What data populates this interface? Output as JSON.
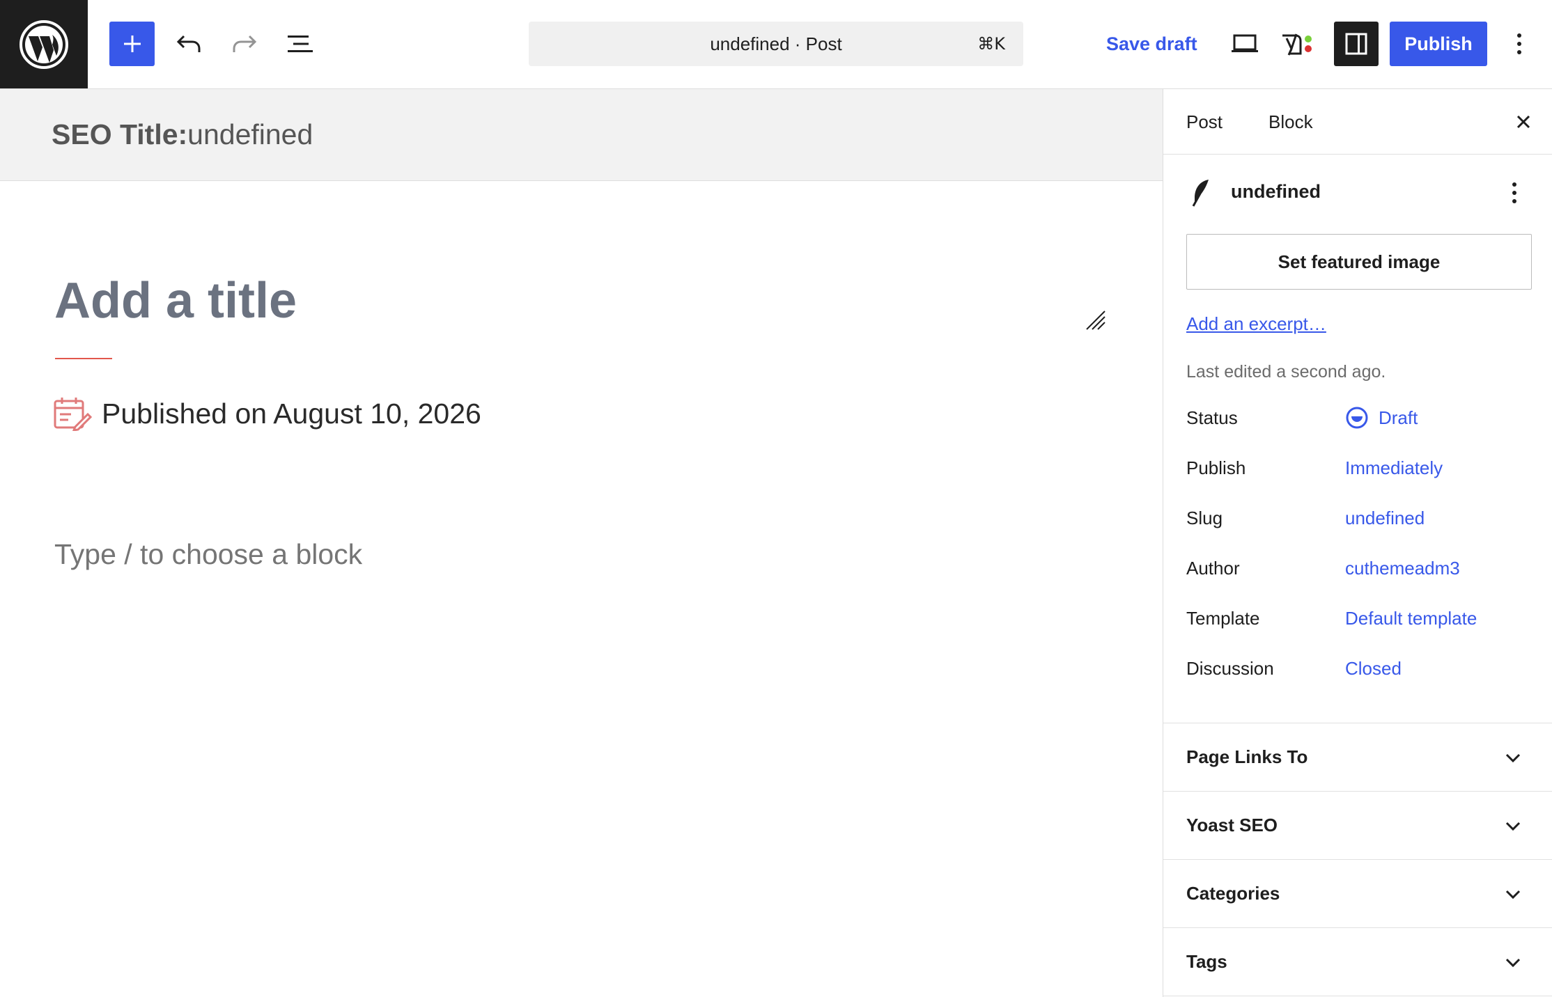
{
  "toolbar": {
    "document_title": "undefined · Post",
    "shortcut": "⌘K",
    "save_draft_label": "Save draft",
    "publish_label": "Publish"
  },
  "seo_bar": {
    "label": "SEO Title:",
    "value": "undefined"
  },
  "editor": {
    "title_placeholder": "Add a title",
    "published_text": "Published on August 10, 2026",
    "block_placeholder": "Type / to choose a block"
  },
  "sidebar": {
    "tabs": [
      {
        "label": "Post"
      },
      {
        "label": "Block"
      }
    ],
    "post_name": "undefined",
    "featured_image_label": "Set featured image",
    "excerpt_link": "Add an excerpt…",
    "last_edited": "Last edited a second ago.",
    "meta": [
      {
        "label": "Status",
        "value": "Draft"
      },
      {
        "label": "Publish",
        "value": "Immediately"
      },
      {
        "label": "Slug",
        "value": "undefined"
      },
      {
        "label": "Author",
        "value": "cuthemeadm3"
      },
      {
        "label": "Template",
        "value": "Default template"
      },
      {
        "label": "Discussion",
        "value": "Closed"
      }
    ],
    "panels": [
      {
        "title": "Page Links To"
      },
      {
        "title": "Yoast SEO"
      },
      {
        "title": "Categories"
      },
      {
        "title": "Tags"
      }
    ]
  },
  "colors": {
    "accent": "#3858e9",
    "dark": "#1e1e1e",
    "title_underline": "#e2574c",
    "calendar_icon": "#e07a7a"
  },
  "icons": [
    "wordpress-logo-icon",
    "plus-icon",
    "undo-icon",
    "redo-icon",
    "list-view-icon",
    "preview-desktop-icon",
    "yoast-icon",
    "sidebar-settings-icon",
    "more-vertical-icon",
    "close-icon",
    "resize-handle-icon",
    "calendar-edit-icon",
    "post-feather-icon",
    "draft-status-icon",
    "chevron-down-icon"
  ]
}
